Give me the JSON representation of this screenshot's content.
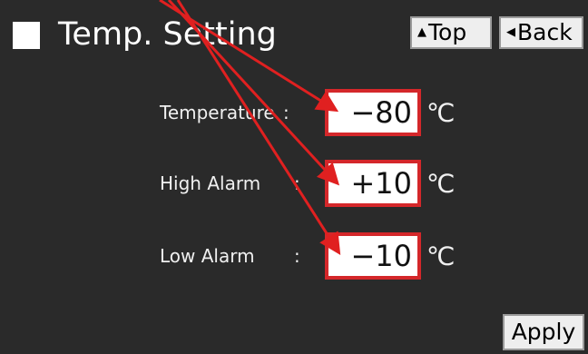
{
  "header": {
    "title": "Temp. Setting",
    "top_button": "Top",
    "back_button": "Back",
    "top_arrow_icon": "up-arrow",
    "back_arrow_icon": "left-triangle"
  },
  "rows": [
    {
      "label": "Temperature",
      "colon": ":",
      "value": "−80",
      "unit": "℃"
    },
    {
      "label": "High Alarm",
      "colon": ":",
      "value": "+10",
      "unit": "℃"
    },
    {
      "label": "Low Alarm",
      "colon": ":",
      "value": "−10",
      "unit": "℃"
    }
  ],
  "apply_button": "Apply",
  "colors": {
    "background": "#2a2a2a",
    "highlight": "#d4272a",
    "button_bg": "#eeeeee"
  }
}
